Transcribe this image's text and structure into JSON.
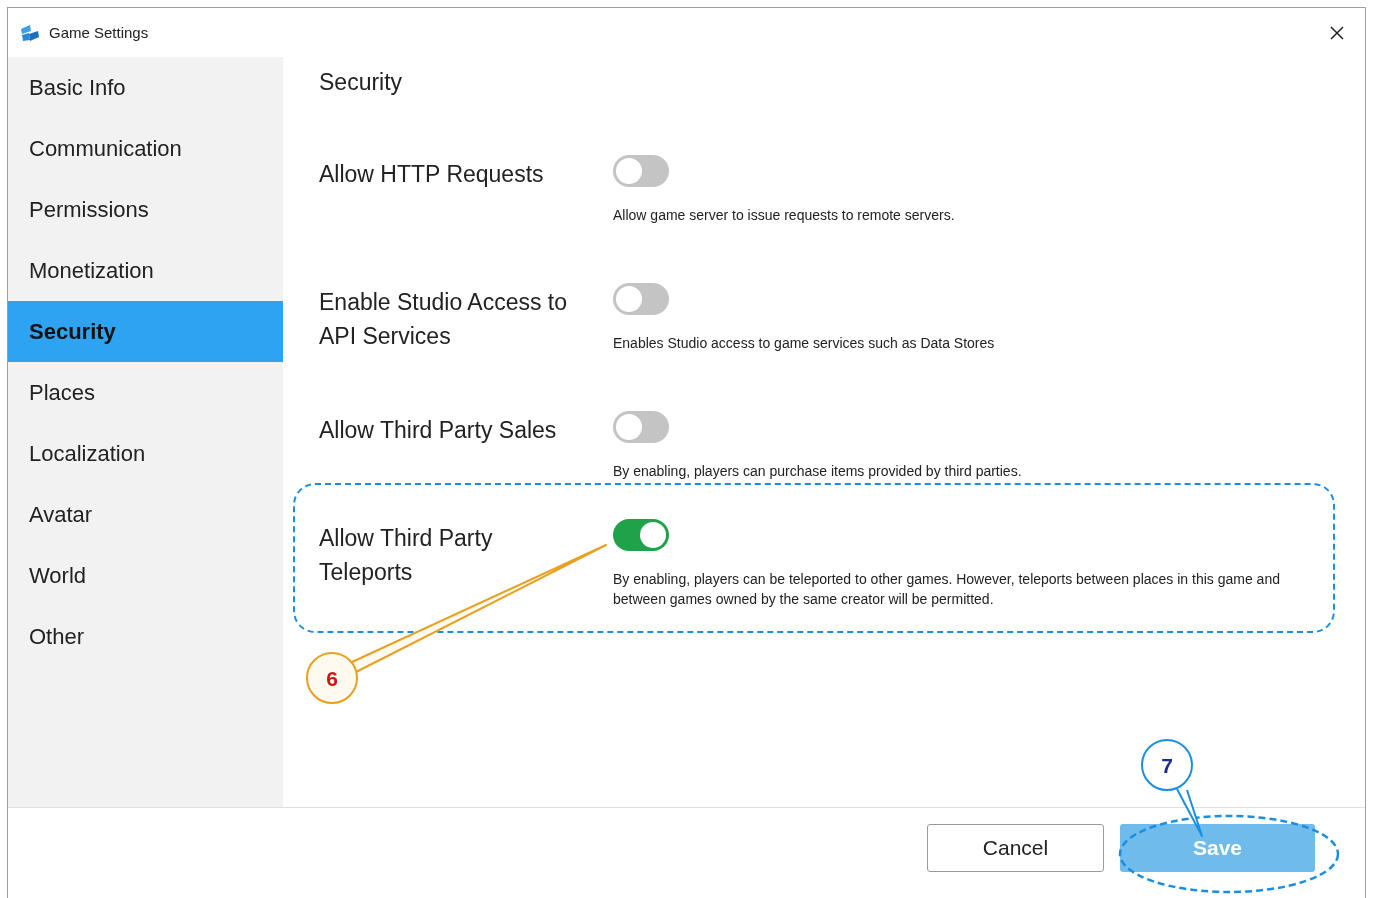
{
  "window": {
    "title": "Game Settings"
  },
  "sidebar": {
    "items": [
      {
        "label": "Basic Info",
        "selected": false
      },
      {
        "label": "Communication",
        "selected": false
      },
      {
        "label": "Permissions",
        "selected": false
      },
      {
        "label": "Monetization",
        "selected": false
      },
      {
        "label": "Security",
        "selected": true
      },
      {
        "label": "Places",
        "selected": false
      },
      {
        "label": "Localization",
        "selected": false
      },
      {
        "label": "Avatar",
        "selected": false
      },
      {
        "label": "World",
        "selected": false
      },
      {
        "label": "Other",
        "selected": false
      }
    ]
  },
  "page_title": "Security",
  "settings": [
    {
      "label": "Allow HTTP Requests",
      "on": false,
      "highlighted": false,
      "description": "Allow game server to issue requests to remote servers."
    },
    {
      "label": "Enable Studio Access to API Services",
      "on": false,
      "highlighted": false,
      "description": "Enables Studio access to game services such as Data Stores"
    },
    {
      "label": "Allow Third Party Sales",
      "on": false,
      "highlighted": false,
      "description": "By enabling, players can purchase items provided by third parties."
    },
    {
      "label": "Allow Third Party Teleports",
      "on": true,
      "highlighted": true,
      "description": "By enabling, players can be teleported to other games. However, teleports between places in this game and between games owned by the same creator will be permitted."
    }
  ],
  "footer": {
    "buttons": [
      {
        "label": "Cancel",
        "kind": "secondary",
        "disabled": false
      },
      {
        "label": "Save",
        "kind": "primary",
        "disabled": true
      }
    ]
  },
  "annotations": [
    {
      "label": "6",
      "kind": "toggle"
    },
    {
      "label": "7",
      "kind": "save"
    },
    {
      "kind": "save_ring"
    }
  ]
}
